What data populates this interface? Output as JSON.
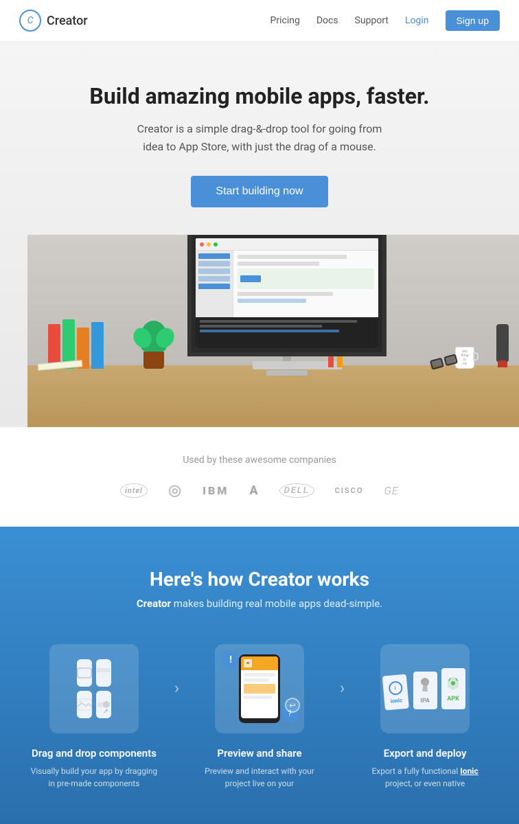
{
  "nav": {
    "logo_letter": "C",
    "logo_name": "Creator",
    "links": [
      {
        "label": "Pricing",
        "id": "pricing"
      },
      {
        "label": "Docs",
        "id": "docs"
      },
      {
        "label": "Support",
        "id": "support"
      }
    ],
    "login_label": "Login",
    "signup_label": "Sign up"
  },
  "hero": {
    "title": "Build amazing mobile apps, faster.",
    "subtitle_line1": "Creator is a simple drag-&-drop tool for going from",
    "subtitle_line2": "idea to App Store, with just the drag of a mouse.",
    "cta_label": "Start building now"
  },
  "companies": {
    "heading": "Used by these awesome companies",
    "logos": [
      {
        "name": "intel",
        "label": "intel"
      },
      {
        "name": "target",
        "label": "◎"
      },
      {
        "name": "ibm",
        "label": "IBM"
      },
      {
        "name": "adobe",
        "label": "A"
      },
      {
        "name": "dell",
        "label": "DELL"
      },
      {
        "name": "cisco",
        "label": "CISCO"
      },
      {
        "name": "ge",
        "label": "GE"
      }
    ]
  },
  "how": {
    "title": "Here's how Creator works",
    "subtitle_plain": " makes building real mobile apps dead-simple.",
    "subtitle_brand": "Creator",
    "steps": [
      {
        "id": "drag-drop",
        "title": "Drag and drop components",
        "desc": "Visually build your app by dragging in pre-made components"
      },
      {
        "id": "preview-share",
        "title": "Preview and share",
        "desc": "Preview and interact with your project live on your"
      },
      {
        "id": "export-deploy",
        "title": "Export and deploy",
        "desc": "Export a fully functional Ionic project, or even native"
      }
    ],
    "arrow_label": "›"
  }
}
